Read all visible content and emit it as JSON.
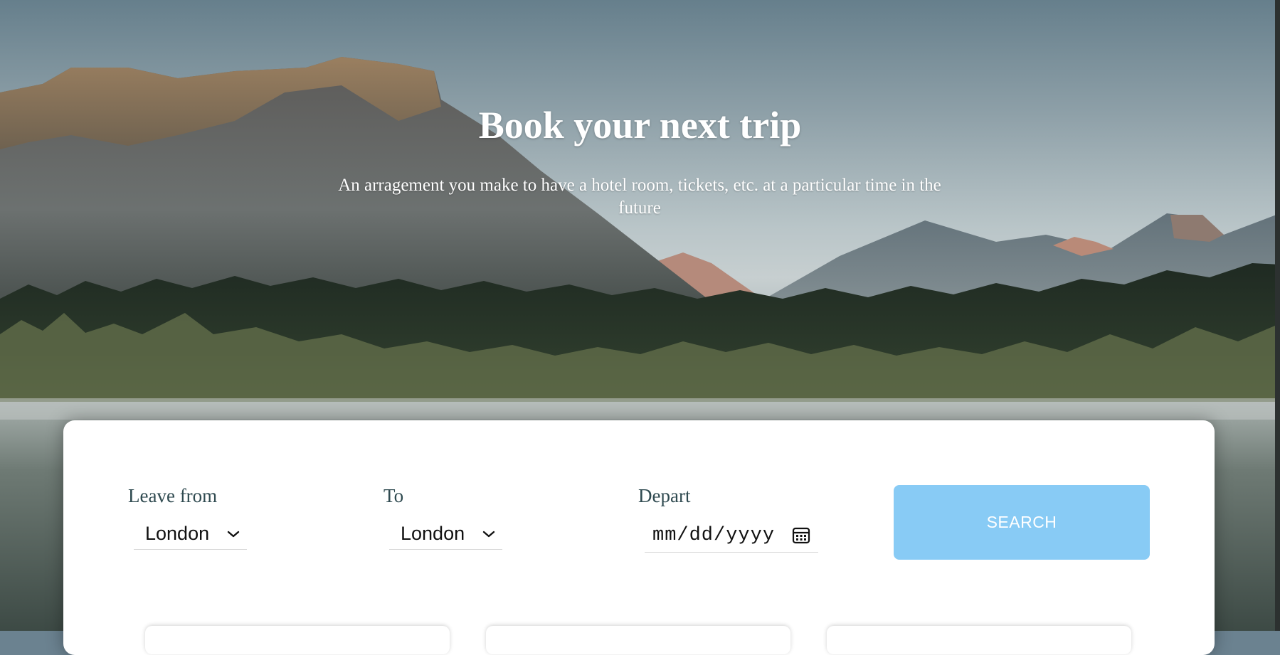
{
  "hero": {
    "title": "Book your next trip",
    "subtitle": "An arragement you make to have a hotel room, tickets, etc. at a particular time in the future"
  },
  "booking": {
    "leave_from": {
      "label": "Leave from",
      "value": "London",
      "icon": "chevron-down-icon"
    },
    "to": {
      "label": "To",
      "value": "London",
      "icon": "chevron-down-icon"
    },
    "depart": {
      "label": "Depart",
      "placeholder": "mm/dd/yyyy",
      "icon": "calendar-icon"
    },
    "search_label": "SEARCH"
  },
  "colors": {
    "search_button": "#88cbf5",
    "label_text": "#2f4a50",
    "card_background": "#ffffff"
  }
}
